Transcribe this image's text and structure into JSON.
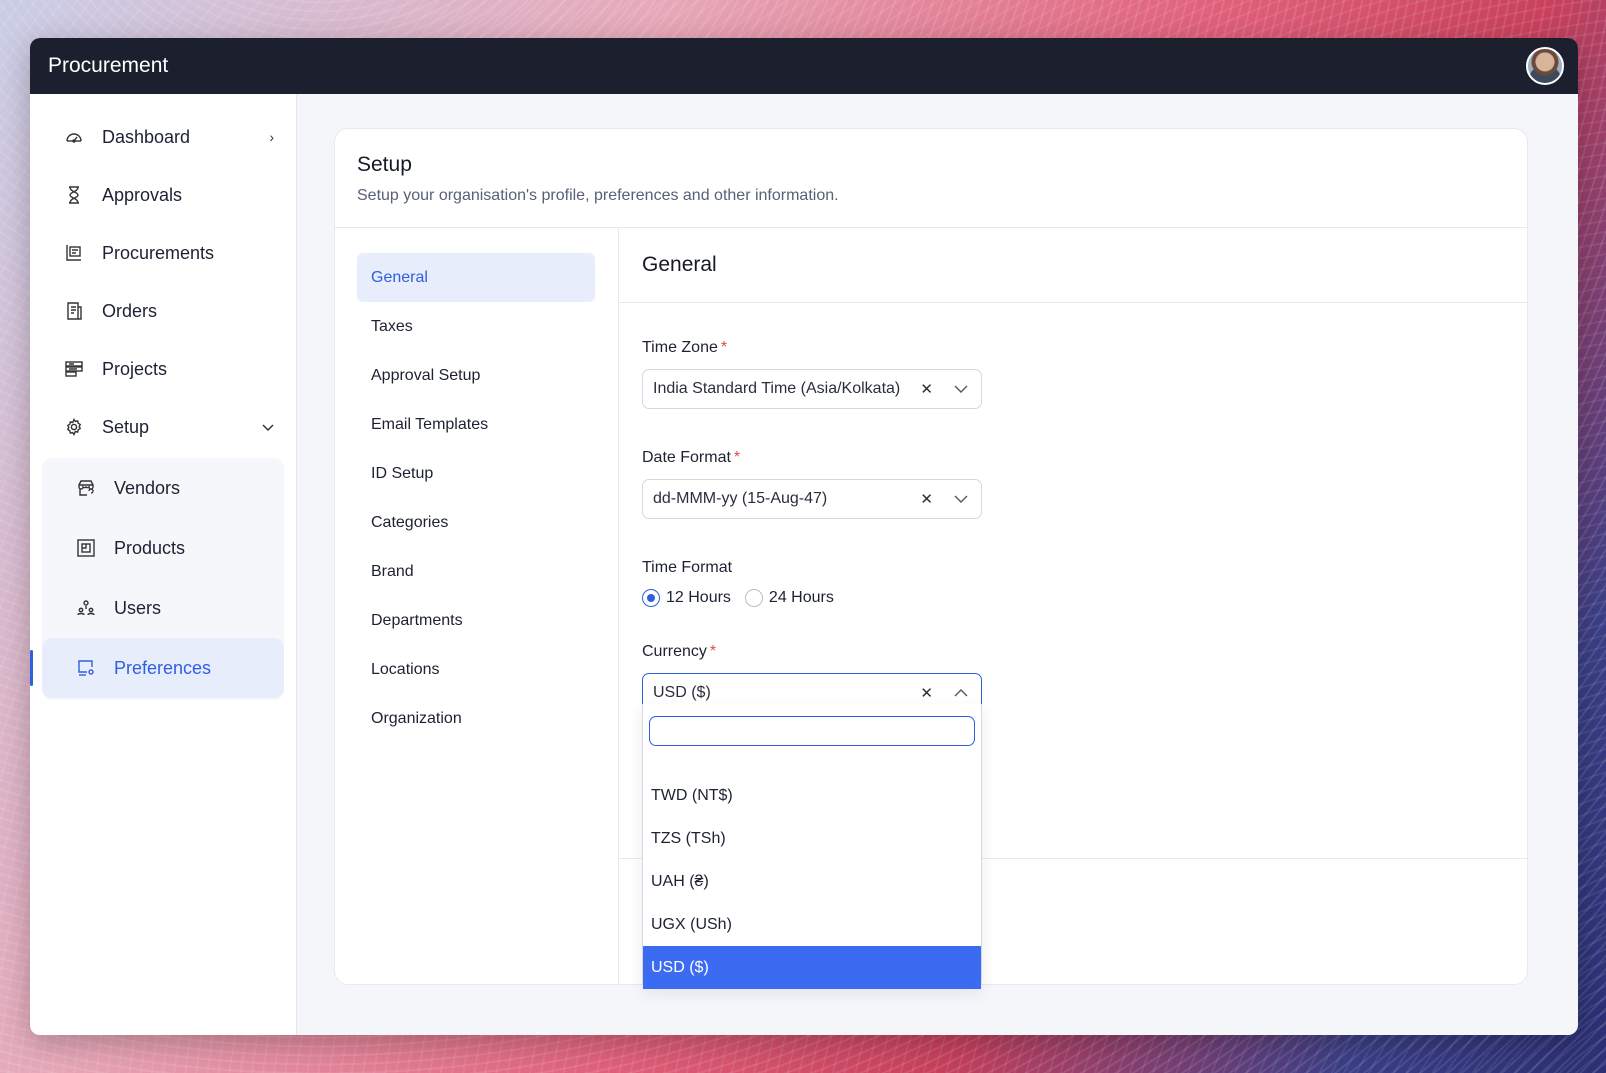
{
  "app": {
    "title": "Procurement"
  },
  "sidebar": {
    "items": [
      {
        "label": "Dashboard",
        "icon": "dashboard-icon",
        "chevron": "›"
      },
      {
        "label": "Approvals",
        "icon": "hourglass-icon"
      },
      {
        "label": "Procurements",
        "icon": "procurement-icon"
      },
      {
        "label": "Orders",
        "icon": "receipt-icon"
      },
      {
        "label": "Projects",
        "icon": "projects-icon"
      },
      {
        "label": "Setup",
        "icon": "gear-icon",
        "chevron": "⌄"
      }
    ],
    "setup_sub": [
      {
        "label": "Vendors",
        "icon": "store-icon"
      },
      {
        "label": "Products",
        "icon": "products-icon"
      },
      {
        "label": "Users",
        "icon": "users-icon"
      },
      {
        "label": "Preferences",
        "icon": "preferences-icon",
        "active": true
      }
    ]
  },
  "setup": {
    "title": "Setup",
    "subtitle": "Setup your organisation's profile, preferences and other information.",
    "nav": [
      "General",
      "Taxes",
      "Approval Setup",
      "Email Templates",
      "ID Setup",
      "Categories",
      "Brand",
      "Departments",
      "Locations",
      "Organization"
    ],
    "active_nav": "General"
  },
  "general": {
    "title": "General",
    "time_zone": {
      "label": "Time Zone",
      "required": "*",
      "value": "India Standard Time (Asia/Kolkata)"
    },
    "date_format": {
      "label": "Date Format",
      "required": "*",
      "value": "dd-MMM-yy (15-Aug-47)"
    },
    "time_format": {
      "label": "Time Format",
      "options": [
        "12 Hours",
        "24 Hours"
      ],
      "selected": "12 Hours"
    },
    "currency": {
      "label": "Currency",
      "required": "*",
      "value": "USD ($)",
      "search_placeholder": "",
      "options": [
        "TWD (NT$)",
        "TZS (TSh)",
        "UAH (₴)",
        "UGX (USh)",
        "USD ($)"
      ],
      "selected": "USD ($)"
    },
    "clear_glyph": "✕"
  },
  "colors": {
    "accent": "#2f5fe0",
    "topbar": "#1b1f2e",
    "selected_option": "#3b6bf0",
    "required": "#e5484d"
  }
}
